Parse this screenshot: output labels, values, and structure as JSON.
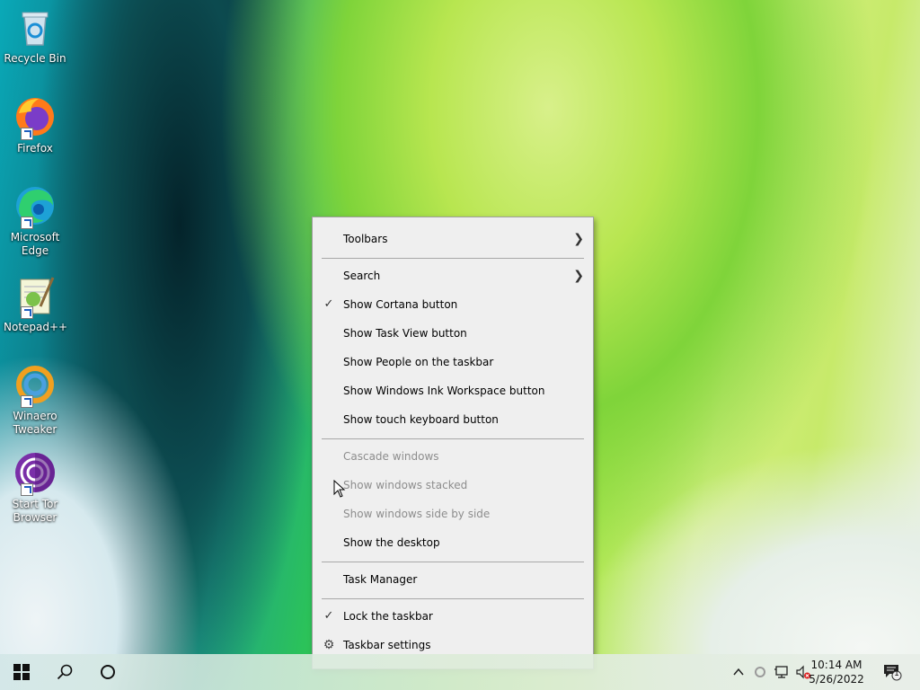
{
  "desktop": {
    "icons": [
      {
        "label_line1": "Recycle Bin",
        "label_line2": "",
        "icon": "recycle-bin-icon"
      },
      {
        "label_line1": "Firefox",
        "label_line2": "",
        "icon": "firefox-icon"
      },
      {
        "label_line1": "Microsoft",
        "label_line2": "Edge",
        "icon": "edge-icon"
      },
      {
        "label_line1": "Notepad++",
        "label_line2": "",
        "icon": "notepad-plus-plus-icon"
      },
      {
        "label_line1": "Winaero",
        "label_line2": "Tweaker",
        "icon": "winaero-tweaker-icon"
      },
      {
        "label_line1": "Start Tor",
        "label_line2": "Browser",
        "icon": "tor-browser-icon"
      }
    ]
  },
  "context_menu": {
    "items": [
      {
        "label": "Toolbars",
        "submenu": true
      },
      {
        "label": "Search",
        "submenu": true
      },
      {
        "label": "Show Cortana button",
        "checked": true
      },
      {
        "label": "Show Task View button"
      },
      {
        "label": "Show People on the taskbar"
      },
      {
        "label": "Show Windows Ink Workspace button"
      },
      {
        "label": "Show touch keyboard button"
      },
      {
        "label": "Cascade windows",
        "disabled": true
      },
      {
        "label": "Show windows stacked",
        "disabled": true
      },
      {
        "label": "Show windows side by side",
        "disabled": true
      },
      {
        "label": "Show the desktop"
      },
      {
        "label": "Task Manager"
      },
      {
        "label": "Lock the taskbar",
        "checked": true
      },
      {
        "label": "Taskbar settings",
        "icon": "gear-icon"
      }
    ]
  },
  "taskbar": {
    "time": "10:14 AM",
    "date": "5/26/2022",
    "notification_count": "1"
  }
}
